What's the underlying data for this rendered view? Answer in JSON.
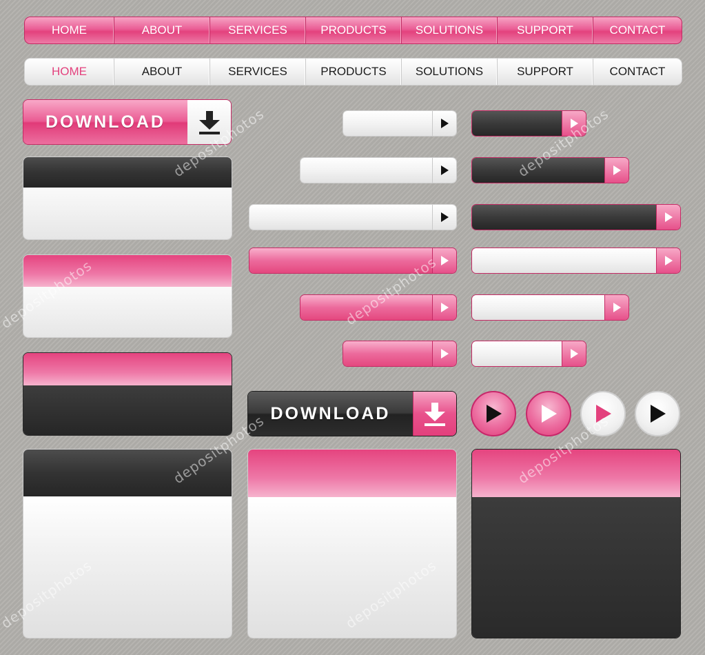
{
  "nav_pink": {
    "items": [
      "HOME",
      "ABOUT",
      "SERVICES",
      "PRODUCTS",
      "SOLUTIONS",
      "SUPPORT",
      "CONTACT"
    ]
  },
  "nav_white": {
    "items": [
      "HOME",
      "ABOUT",
      "SERVICES",
      "PRODUCTS",
      "SOLUTIONS",
      "SUPPORT",
      "CONTACT"
    ],
    "active": "HOME"
  },
  "download_pink": {
    "label": "DOWNLOAD",
    "icon": "download-icon"
  },
  "download_dark": {
    "label": "DOWNLOAD",
    "icon": "download-icon"
  },
  "icons": {
    "arrow": "play-arrow-icon",
    "download": "download-arrow-icon"
  },
  "watermark": {
    "text": "depositphotos"
  },
  "colors": {
    "pink": "#e3417d",
    "dark": "#2b2b2b",
    "white": "#f4f4f4",
    "background": "#b1afab"
  }
}
